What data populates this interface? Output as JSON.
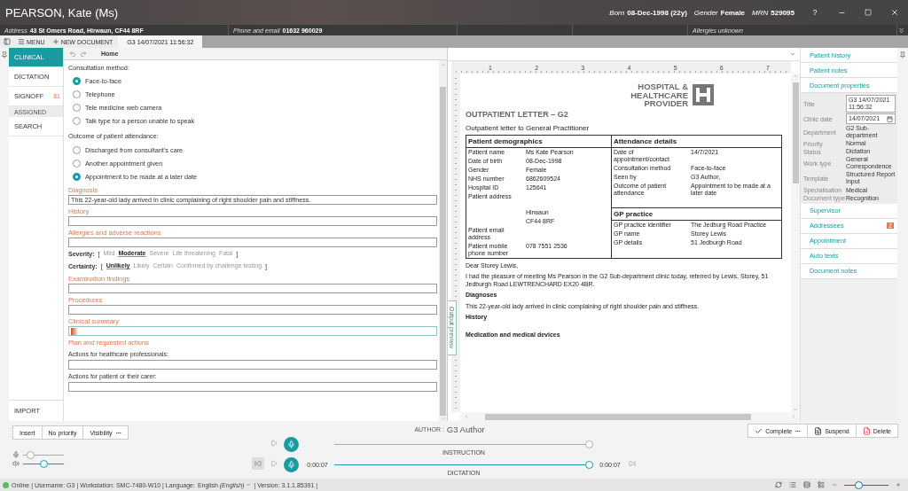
{
  "window": {
    "title": "PEARSON, Kate (Ms)",
    "help": "?"
  },
  "patient_summary": [
    {
      "label": "Born",
      "value": "08-Dec-1998 (22y)"
    },
    {
      "label": "Gender",
      "value": "Female"
    },
    {
      "label": "MRN",
      "value": "529095"
    }
  ],
  "info_bar": {
    "fields": [
      {
        "label": "Address",
        "value": "43 St Omers Road, Hirwaun, CF44 8RF"
      },
      {
        "label": "Phone and email",
        "value": "01632 960029"
      }
    ],
    "allergies": "Allergies unknown"
  },
  "toolbar": {
    "menu": "MENU",
    "new_document": "NEW DOCUMENT",
    "tabs": [
      {
        "label": "G3 14/07/2021 11:56:32",
        "selected": true
      }
    ]
  },
  "nav": {
    "items": [
      {
        "label": "CLINICAL",
        "selected": true
      },
      {
        "label": "DICTATION",
        "selected": false
      },
      {
        "label": "SIGNOFF",
        "selected": false,
        "badge": "81",
        "children": [
          {
            "label": "ASSIGNED",
            "selected": false
          }
        ]
      },
      {
        "label": "SEARCH",
        "selected": false
      }
    ],
    "footer": "IMPORT"
  },
  "editor": {
    "ribbon_tab": "Home",
    "form": [
      {
        "kind": "label",
        "text": "Consultation method:"
      },
      {
        "kind": "radio",
        "label": "Face-to-face",
        "selected": true
      },
      {
        "kind": "radio",
        "label": "Telephone",
        "selected": false
      },
      {
        "kind": "radio",
        "label": "Tele medicine web camera",
        "selected": false
      },
      {
        "kind": "radio",
        "label": "Talk type for a person unable to speak",
        "selected": false
      },
      {
        "kind": "label",
        "text": "Outcome of patient attendance:"
      },
      {
        "kind": "radio",
        "label": "Discharged from consultant’s care",
        "selected": false
      },
      {
        "kind": "radio",
        "label": "Another appointment given",
        "selected": false
      },
      {
        "kind": "radio",
        "label": "Appointment to be made at a later date",
        "selected": true
      },
      {
        "kind": "section",
        "title": "Diagnosis"
      },
      {
        "kind": "field",
        "value": "This 22-year-old lady arrived in clinic complaining of right shoulder pain and stiffness.",
        "focused": false
      },
      {
        "kind": "section",
        "title": "History"
      },
      {
        "kind": "field",
        "focused": false
      },
      {
        "kind": "section",
        "title": "Allergies and adverse reactions"
      },
      {
        "kind": "field",
        "focused": false
      },
      {
        "kind": "scale",
        "label": "Severity:",
        "open": "[",
        "close": "]",
        "options": [
          {
            "label": "Mild",
            "selected": false
          },
          {
            "label": "Moderate",
            "selected": true
          },
          {
            "label": "Severe",
            "selected": false
          },
          {
            "label": "Life threatening",
            "selected": false
          },
          {
            "label": "Fatal",
            "selected": false
          }
        ]
      },
      {
        "kind": "scale",
        "label": "Certainty:",
        "open": "[",
        "close": "]",
        "options": [
          {
            "label": "Unlikely",
            "selected": true
          },
          {
            "label": "Likely",
            "selected": false
          },
          {
            "label": "Certain",
            "selected": false
          },
          {
            "label": "Confirmed by challenge testing",
            "selected": false
          }
        ]
      },
      {
        "kind": "section",
        "title": "Examination findings"
      },
      {
        "kind": "field",
        "focused": false
      },
      {
        "kind": "section",
        "title": "Procedures"
      },
      {
        "kind": "field",
        "focused": false
      },
      {
        "kind": "section",
        "title": "Clinical summary"
      },
      {
        "kind": "field",
        "focused": true
      },
      {
        "kind": "section",
        "title": "Plan and requested actions"
      },
      {
        "kind": "subheading",
        "text": "Actions for healthcare professionals:"
      },
      {
        "kind": "field",
        "focused": false
      },
      {
        "kind": "subheading",
        "text": "Actions for patient or their carer:"
      },
      {
        "kind": "field",
        "focused": false
      }
    ]
  },
  "document": {
    "ruler_labels": [
      "1",
      "2",
      "3",
      "4",
      "5",
      "6",
      "7"
    ],
    "side_tab": "Output preview",
    "logo": [
      "HOSPITAL &",
      "HEALTHCARE",
      "PROVIDER"
    ],
    "title": "OUTPATIENT LETTER – G2",
    "subtitle": "Outpatient letter to General Practitioner",
    "demographics": {
      "heading": "Patient demographics",
      "rows": [
        {
          "label": "Patient name",
          "value": "Ms Kate Pearson"
        },
        {
          "label": "Date of birth",
          "value": "08-Dec-1998"
        },
        {
          "label": "Gender",
          "value": "Female"
        },
        {
          "label": "NHS number",
          "value": "6862609524"
        },
        {
          "label": "Hospital ID",
          "value": "125641"
        },
        {
          "label": "Patient address"
        }
      ],
      "lower_rows": [
        {
          "value": "Hirwaun"
        },
        {
          "value": "CF44 8RF"
        },
        {
          "label": "Patient email address"
        },
        {
          "label": "Patient mobile phone number",
          "value": "078 7551 2536"
        }
      ]
    },
    "attendance": {
      "heading": "Attendance details",
      "rows": [
        {
          "label": "Date of appointment/contact",
          "value": "14/7/2021"
        },
        {
          "label": "Consultation method",
          "value": "Face-to-face"
        },
        {
          "label": "Seen by",
          "value": "G3 Author,"
        },
        {
          "label": "Outcome of patient attendance",
          "value": "Appointment to be made at a later date"
        }
      ]
    },
    "gp_practice": {
      "heading": "GP practice",
      "rows": [
        {
          "label": "GP practice identifier",
          "value": "The Jedburg Road Practice"
        },
        {
          "label": "GP name",
          "value": "Storey Lewis"
        },
        {
          "label": "GP details",
          "value": "51 Jedburgh Road"
        }
      ]
    },
    "body": [
      {
        "kind": "text",
        "text": "Dear  Storey Lewis,"
      },
      {
        "kind": "text",
        "text": "I had the pleasure of meeting Ms Pearson in the G2 Sub-department clinic today, referred by Lewis, Storey, 51 Jedburgh Road LEWTRENCHARD EX20 4BR."
      },
      {
        "kind": "heading",
        "text": "Diagnoses"
      },
      {
        "kind": "text",
        "text": "This 22-year-old lady arrived in clinic complaining of right shoulder pain and stiffness."
      },
      {
        "kind": "heading",
        "text": "History"
      },
      {
        "kind": "spacer"
      },
      {
        "kind": "heading",
        "text": "Medication and medical devices"
      }
    ]
  },
  "panel": {
    "sections": [
      {
        "label": "Patient history"
      },
      {
        "label": "Patient notes"
      },
      {
        "label": "Document properties",
        "properties": [
          {
            "kind": "field",
            "label": "Title",
            "value": "G3 14/07/2021 11:56:32"
          },
          {
            "kind": "date",
            "label": "Clinic date",
            "value": "14/07/2021"
          },
          {
            "kind": "text",
            "label": "Department",
            "value": "G2 Sub-department"
          },
          {
            "kind": "text",
            "label": "Priority",
            "value": "Normal"
          },
          {
            "kind": "text",
            "label": "Status",
            "value": "Dictation"
          },
          {
            "kind": "text",
            "label": "Work type",
            "value": "General Correspondence"
          },
          {
            "kind": "text",
            "label": "Template",
            "value": "Structured Report Input"
          },
          {
            "kind": "text",
            "label": "Specialisation",
            "value": "Medical"
          },
          {
            "kind": "text",
            "label": "Document type",
            "value": "Recognition"
          }
        ]
      },
      {
        "label": "Supervisor"
      },
      {
        "label": "Addressees",
        "badge": "2"
      },
      {
        "label": "Appointment"
      },
      {
        "label": "Auto texts"
      },
      {
        "label": "Document notes"
      }
    ]
  },
  "actions": {
    "left": [
      {
        "label": "Insert",
        "menu": false
      },
      {
        "label": "No priority",
        "menu": false
      },
      {
        "label": "Visibility",
        "menu": true
      }
    ],
    "author_label": "AUTHOR :",
    "author": "G3 Author",
    "right": [
      {
        "kind": "complete",
        "label": "Complete",
        "menu": true
      },
      {
        "kind": "suspend",
        "label": "Suspend",
        "menu": false
      },
      {
        "kind": "delete",
        "label": "Delete",
        "menu": false
      }
    ]
  },
  "audio": {
    "mic": {
      "level": 0.12
    },
    "volume": {
      "level": 0.5
    }
  },
  "players": [
    {
      "label": "INSTRUCTION",
      "active": false,
      "level": 1
    },
    {
      "label": "DICTATION",
      "active": true,
      "level": 1,
      "elapsed": "0:00:07",
      "total": "0:00:07"
    }
  ],
  "status_bar": {
    "online": true,
    "text": "Online | Username: G3 | Workstation: SMC-7480-W10 | Language:",
    "language": "English *(English)*",
    "version": "| Version: 3.1.1.85391 |",
    "zoom": {
      "level": 0.3
    }
  }
}
